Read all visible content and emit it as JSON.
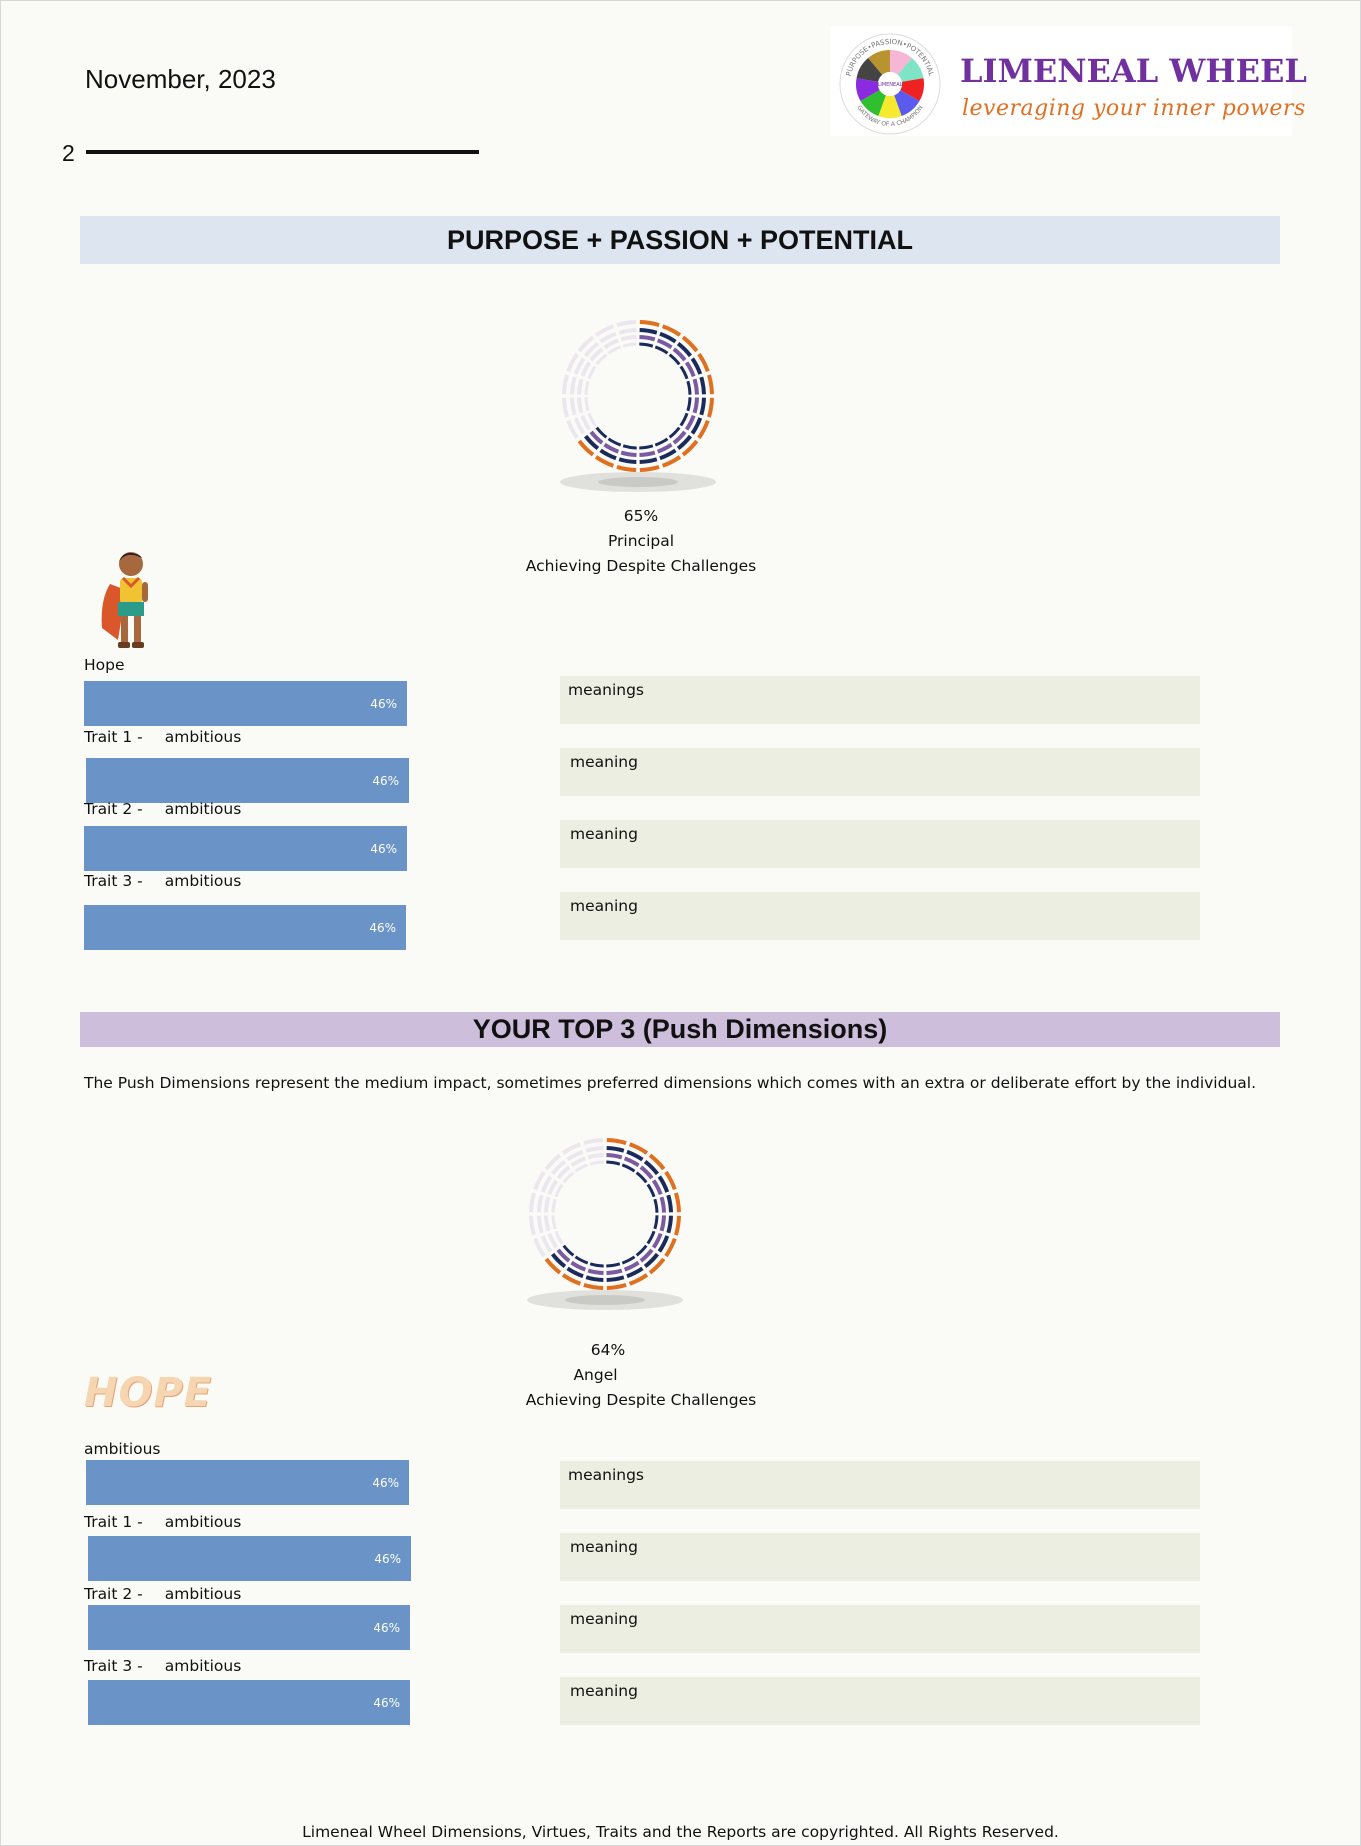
{
  "header": {
    "date": "November, 2023",
    "page_number": "2"
  },
  "logo": {
    "title": "LIMENEAL WHEEL",
    "tagline": "leveraging your inner powers",
    "wheel_top_text": "PURPOSE•PASSION•POTENTIAL",
    "wheel_bottom_text": "GATEWAY OF A CHAMPION",
    "wheel_center_text": "LIMENEAL",
    "segment_colors": [
      "#f6b6d6",
      "#7fe3c6",
      "#ee2222",
      "#5b5bee",
      "#f6ea30",
      "#2fbf2f",
      "#8a2be2",
      "#444444",
      "#b8932e"
    ]
  },
  "section1": {
    "banner": "PURPOSE + PASSION + POTENTIAL",
    "score_percent": "65%",
    "score_percent_value": 65,
    "archetype": "Principal",
    "theme": "Achieving Despite Challenges",
    "virtue_label": "Hope",
    "rows": [
      {
        "label_prefix": "",
        "label_word": "",
        "bar_value": "46%",
        "meaning": "meanings"
      },
      {
        "label_prefix": "Trait 1 -",
        "label_word": "ambitious",
        "bar_value": "46%",
        "meaning": "meaning"
      },
      {
        "label_prefix": "Trait 2 -",
        "label_word": "ambitious",
        "bar_value": "46%",
        "meaning": "meaning"
      },
      {
        "label_prefix": "Trait 3 -",
        "label_word": "ambitious",
        "bar_value": "46%",
        "meaning": "meaning"
      }
    ]
  },
  "section2": {
    "banner": "YOUR TOP 3 (Push Dimensions)",
    "intro": "The Push Dimensions represent the medium impact, sometimes preferred dimensions which comes with an extra or deliberate effort by the individual.",
    "score_percent": "64%",
    "score_percent_value": 64,
    "archetype": "Angel",
    "theme": "Achieving Despite Challenges",
    "image_word": "HOPE",
    "virtue_label": "ambitious",
    "rows": [
      {
        "label_prefix": "",
        "label_word": "",
        "bar_value": "46%",
        "meaning": "meanings"
      },
      {
        "label_prefix": "Trait 1 -",
        "label_word": "ambitious",
        "bar_value": "46%",
        "meaning": "meaning"
      },
      {
        "label_prefix": "Trait 2 -",
        "label_word": "ambitious",
        "bar_value": "46%",
        "meaning": "meaning"
      },
      {
        "label_prefix": "Trait 3 -",
        "label_word": "ambitious",
        "bar_value": "46%",
        "meaning": "meaning"
      }
    ]
  },
  "colors": {
    "bar": "#6a94c7",
    "meaning_box": "#ebeee0",
    "banner1": "#dde6f0",
    "banner2": "#cdbfdb",
    "ring_orange": "#e07020",
    "ring_navy": "#1a2a5a",
    "ring_purple": "#7a5aa0"
  },
  "footer": {
    "copyright": "Limeneal Wheel Dimensions, Virtues, Traits and the Reports are copyrighted. All Rights Reserved."
  }
}
